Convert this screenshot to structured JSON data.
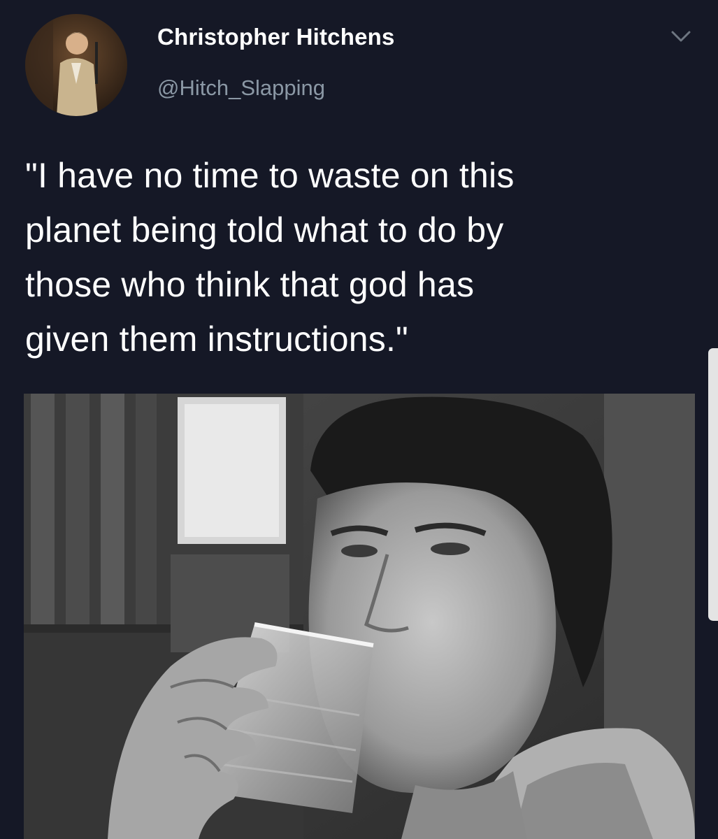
{
  "author": {
    "display_name": "Christopher Hitchens",
    "handle": "@Hitch_Slapping"
  },
  "tweet": {
    "text": "\"I have no time to waste on this\nplanet being told what to do by\nthose who think that god has\ngiven them instructions.\""
  },
  "icons": {
    "avatar": "profile-photo",
    "menu": "chevron-down-icon"
  },
  "colors": {
    "background": "#151826",
    "name": "#ffffff",
    "handle": "#8b98a5",
    "text": "#ffffff"
  }
}
